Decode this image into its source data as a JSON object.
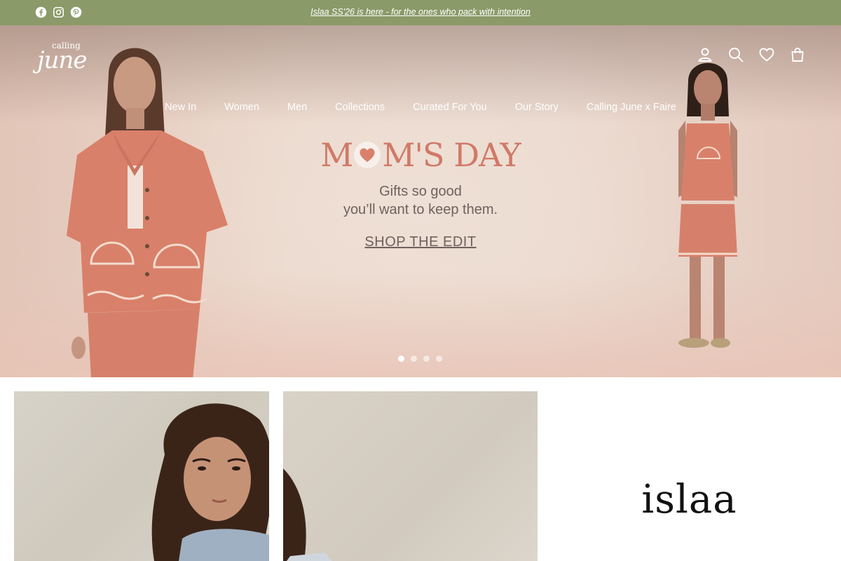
{
  "announcement": {
    "text": "Islaa SS'26 is here - for the ones who pack with intention",
    "social_icons": [
      "facebook-icon",
      "instagram-icon",
      "pinterest-icon"
    ]
  },
  "header": {
    "logo_small": "calling",
    "logo_big": "june",
    "icons": [
      "account-icon",
      "search-icon",
      "wishlist-heart-icon",
      "cart-bag-icon"
    ]
  },
  "nav": {
    "items": [
      "New In",
      "Women",
      "Men",
      "Collections",
      "Curated For You",
      "Our Story",
      "Calling June x Faire"
    ]
  },
  "hero": {
    "headline_before": "M",
    "headline_after": "M'S DAY",
    "subline_1": "Gifts so good",
    "subline_2": "you’ll want to keep them.",
    "cta": "SHOP THE EDIT",
    "slides_total": 4,
    "slide_active": 1
  },
  "tiles": {
    "brand_logo": "islaa"
  },
  "colors": {
    "announcement_bg": "#8a9a68",
    "headline": "#d07a67",
    "garment": "#d9806a"
  }
}
